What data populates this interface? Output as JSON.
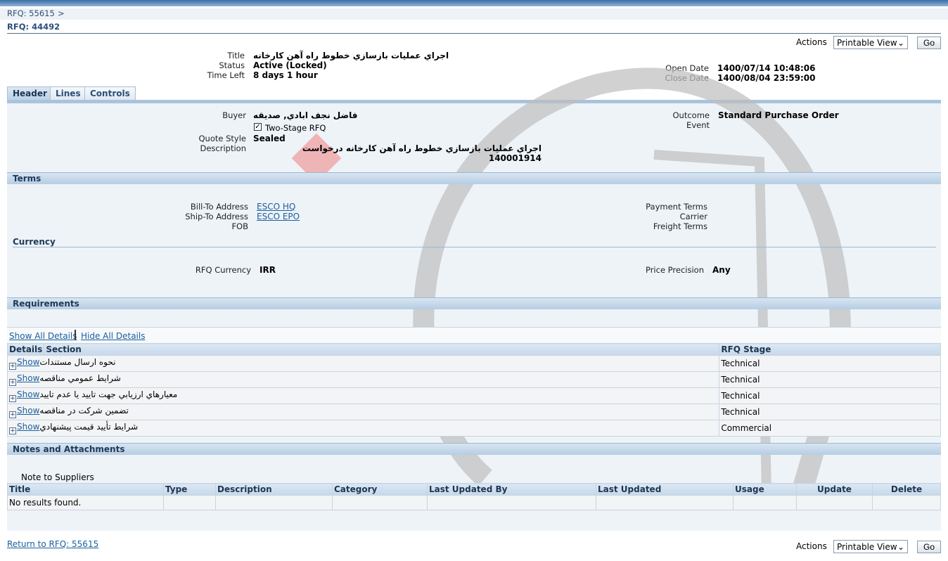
{
  "breadcrumb": {
    "parent": "RFQ: 55615",
    "separator": ">"
  },
  "page_title": "RFQ: 44492",
  "actions": {
    "label": "Actions",
    "selected": "Printable View",
    "go": "Go"
  },
  "summary": {
    "title_label": "Title",
    "title": "اجراي عمليات بازسازي خطوط راه آهن كارخانه",
    "status_label": "Status",
    "status": "Active (Locked)",
    "time_left_label": "Time Left",
    "time_left": "8 days 1 hour",
    "open_date_label": "Open Date",
    "open_date": "1400/07/14 10:48:06",
    "close_date_label": "Close Date",
    "close_date": "1400/08/04 23:59:00"
  },
  "tabs": [
    {
      "label": "Header",
      "active": true
    },
    {
      "label": "Lines"
    },
    {
      "label": "Controls"
    }
  ],
  "header": {
    "buyer_label": "Buyer",
    "buyer": "فاضل نجف ابادي, صديقه",
    "two_stage_label": "Two-Stage RFQ",
    "two_stage_checked": true,
    "quote_style_label": "Quote Style",
    "quote_style": "Sealed",
    "description_label": "Description",
    "description": "اجراي عمليات بازسازي خطوط راه آهن كارخانه درخواست 140001914",
    "outcome_label": "Outcome",
    "outcome": "Standard Purchase Order",
    "event_label": "Event"
  },
  "terms": {
    "title": "Terms",
    "bill_to_label": "Bill-To Address",
    "bill_to": "ESCO HQ",
    "ship_to_label": "Ship-To Address",
    "ship_to": "ESCO EPO",
    "fob_label": "FOB",
    "payment_terms_label": "Payment Terms",
    "carrier_label": "Carrier",
    "freight_terms_label": "Freight Terms"
  },
  "currency": {
    "title": "Currency",
    "rfq_currency_label": "RFQ Currency",
    "rfq_currency": "IRR",
    "price_precision_label": "Price Precision",
    "price_precision": "Any"
  },
  "requirements": {
    "title": "Requirements",
    "show_all": "Show All Details",
    "hide_all": "Hide All Details",
    "columns": [
      "Details",
      "Section",
      "RFQ Stage"
    ],
    "show_label": "Show",
    "rows": [
      {
        "section": "نحوه ارسال مستندات",
        "stage": "Technical"
      },
      {
        "section": "شرايط عمومي مناقصه",
        "stage": "Technical"
      },
      {
        "section": "معيارهاي ارزيابي جهت تاييد يا عدم تاييد",
        "stage": "Technical"
      },
      {
        "section": "تضمين شركت در مناقصه",
        "stage": "Technical"
      },
      {
        "section": "شرايط تأييد قيمت پيشنهادي",
        "stage": "Commercial"
      }
    ]
  },
  "notes": {
    "title": "Notes and Attachments",
    "note_to_suppliers": "Note to Suppliers",
    "columns": [
      "Title",
      "Type",
      "Description",
      "Category",
      "Last Updated By",
      "Last Updated",
      "Usage",
      "Update",
      "Delete"
    ],
    "empty": "No results found."
  },
  "footer": {
    "return_link": "Return to RFQ: 55615"
  }
}
